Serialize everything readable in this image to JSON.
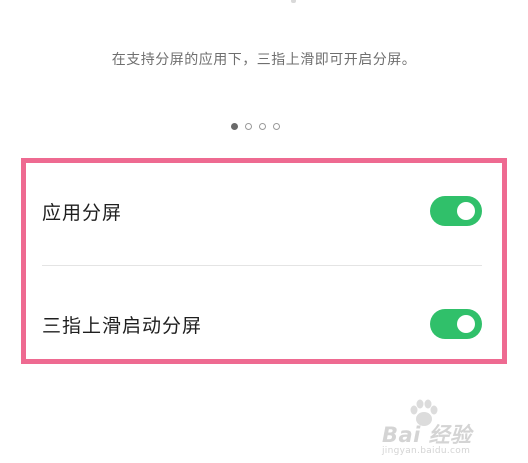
{
  "hint_text": "在支持分屏的应用下，三指上滑即可开启分屏。",
  "pager": {
    "total": 4,
    "active_index": 0
  },
  "settings": [
    {
      "label": "应用分屏",
      "enabled": true
    },
    {
      "label": "三指上滑启动分屏",
      "enabled": true
    }
  ],
  "colors": {
    "toggle_on": "#30c06a",
    "highlight_border": "#ee6a91",
    "hint_text": "#6f6f6f"
  },
  "watermark": {
    "text": "Bai 经验",
    "sub": "jingyan.baidu.com"
  }
}
